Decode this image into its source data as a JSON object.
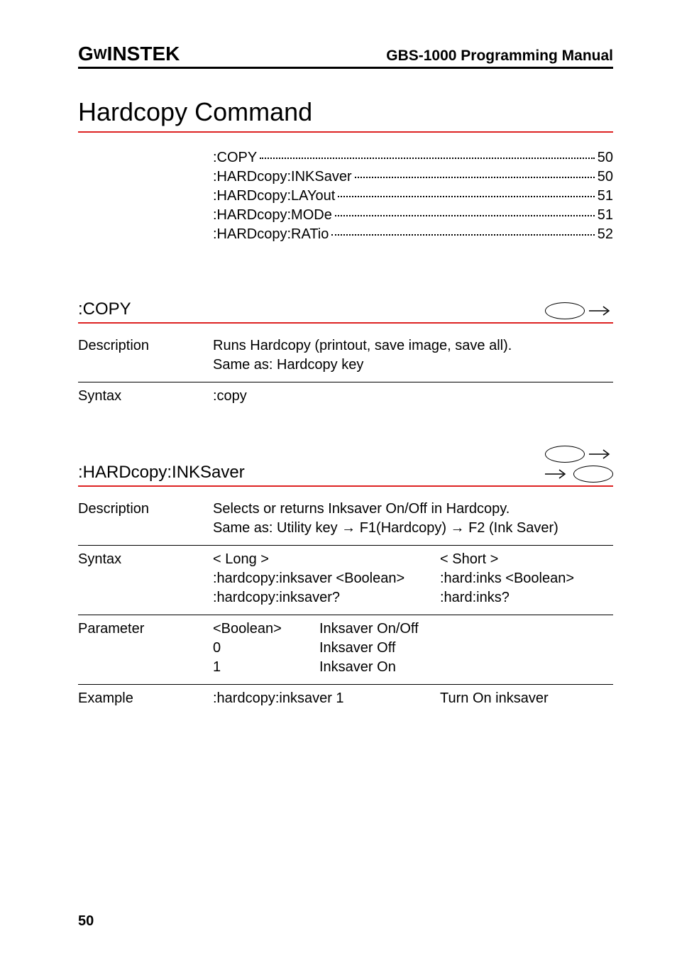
{
  "header": {
    "logo_main": "G",
    "logo_u": "W",
    "logo_rest": "INSTEK",
    "manual_title": "GBS-1000 Programming Manual"
  },
  "section_title": "Hardcopy Command",
  "toc": [
    {
      "label": ":COPY",
      "page": "50"
    },
    {
      "label": ":HARDcopy:INKSaver",
      "page": "50"
    },
    {
      "label": ":HARDcopy:LAYout",
      "page": "51"
    },
    {
      "label": ":HARDcopy:MODe",
      "page": "51"
    },
    {
      "label": ":HARDcopy:RATio",
      "page": "52"
    }
  ],
  "commands": {
    "copy": {
      "name": ":COPY",
      "desc_line1": "Runs Hardcopy (printout, save image, save all).",
      "desc_line2": "Same as: Hardcopy key",
      "syntax": ":copy"
    },
    "inksaver": {
      "name": ":HARDcopy:INKSaver",
      "desc_line1": "Selects or returns Inksaver On/Off in Hardcopy.",
      "desc_line2": "Same as: Utility key → F1(Hardcopy) → F2 (Ink Saver)",
      "syntax_long_h": "< Long >",
      "syntax_short_h": "< Short >",
      "syntax_long1": ":hardcopy:inksaver <Boolean>",
      "syntax_short1": ":hard:inks <Boolean>",
      "syntax_long2": ":hardcopy:inksaver?",
      "syntax_short2": ":hard:inks?",
      "param_bool": "<Boolean>",
      "param_bool_v": "Inksaver On/Off",
      "param_0": "0",
      "param_0_v": "Inksaver Off",
      "param_1": "1",
      "param_1_v": "Inksaver On",
      "example_cmd": ":hardcopy:inksaver 1",
      "example_res": "Turn On inksaver"
    }
  },
  "labels": {
    "description": "Description",
    "syntax": "Syntax",
    "parameter": "Parameter",
    "example": "Example"
  },
  "page_number": "50"
}
